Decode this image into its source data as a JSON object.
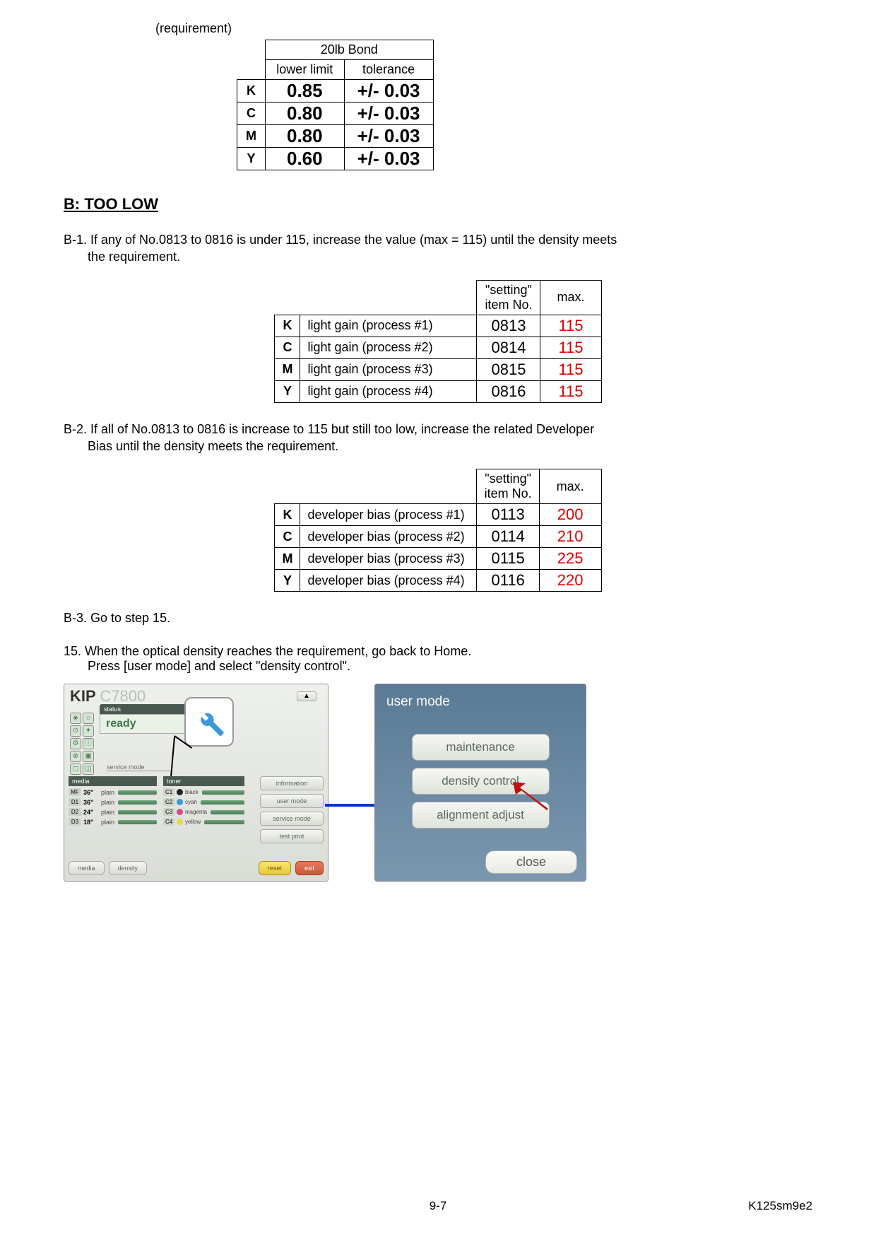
{
  "labels": {
    "requirement": "(requirement)",
    "section_b_title": "B: TOO LOW",
    "b1_text": "B-1. If any of No.0813 to 0816 is under 115, increase the value (max = 115) until the density meets",
    "b1_cont": "the requirement.",
    "b2_text": "B-2. If all of No.0813 to 0816 is increase to 115 but still too low, increase the related Developer",
    "b2_cont": "Bias until the density meets the requirement.",
    "b3_text": "B-3. Go to step 15.",
    "step15_a": "15. When the optical density reaches the requirement, go back to Home.",
    "step15_b": "Press [user mode] and select \"density control\"."
  },
  "req_table": {
    "group_header": "20lb Bond",
    "col1": "lower limit",
    "col2": "tolerance",
    "rows": [
      {
        "label": "K",
        "limit": "0.85",
        "tol": "+/- 0.03"
      },
      {
        "label": "C",
        "limit": "0.80",
        "tol": "+/- 0.03"
      },
      {
        "label": "M",
        "limit": "0.80",
        "tol": "+/- 0.03"
      },
      {
        "label": "Y",
        "limit": "0.60",
        "tol": "+/- 0.03"
      }
    ]
  },
  "setting_headers": {
    "col_setting": "\"setting\"",
    "col_itemno": "item No.",
    "col_max": "max."
  },
  "light_gain_table": [
    {
      "k": "K",
      "desc": "light gain (process #1)",
      "num": "0813",
      "max": "115"
    },
    {
      "k": "C",
      "desc": "light gain (process #2)",
      "num": "0814",
      "max": "115"
    },
    {
      "k": "M",
      "desc": "light gain (process #3)",
      "num": "0815",
      "max": "115"
    },
    {
      "k": "Y",
      "desc": "light gain (process #4)",
      "num": "0816",
      "max": "115"
    }
  ],
  "dev_bias_table": [
    {
      "k": "K",
      "desc": "developer bias (process #1)",
      "num": "0113",
      "max": "200"
    },
    {
      "k": "C",
      "desc": "developer bias (process #2)",
      "num": "0114",
      "max": "210"
    },
    {
      "k": "M",
      "desc": "developer bias (process #3)",
      "num": "0115",
      "max": "225"
    },
    {
      "k": "Y",
      "desc": "developer bias (process #4)",
      "num": "0116",
      "max": "220"
    }
  ],
  "left_screen": {
    "brand": "KIP",
    "model": "C7800",
    "status_label": "status",
    "ready": "ready",
    "service_mode": "service mode",
    "media_title": "media",
    "toner_title": "toner",
    "media": [
      {
        "slot": "MF",
        "size": "36\"",
        "type": "plain"
      },
      {
        "slot": "D1",
        "size": "36\"",
        "type": "plain"
      },
      {
        "slot": "D2",
        "size": "24\"",
        "type": "plain"
      },
      {
        "slot": "D3",
        "size": "18\"",
        "type": "plain"
      }
    ],
    "toner": [
      {
        "slot": "C1",
        "name": "black",
        "color": "#222"
      },
      {
        "slot": "C2",
        "name": "cyan",
        "color": "#3a9ad8"
      },
      {
        "slot": "C3",
        "name": "magenta",
        "color": "#d84a8a"
      },
      {
        "slot": "C4",
        "name": "yellow",
        "color": "#e8d84a"
      }
    ],
    "right_btns": [
      "information",
      "user mode",
      "service mode",
      "test print"
    ],
    "bottom_left": [
      "media",
      "density"
    ],
    "reset": "reset",
    "exit": "exit",
    "arrow_up": "▲"
  },
  "right_screen": {
    "title": "user mode",
    "buttons": [
      "maintenance",
      "density control",
      "alignment adjust"
    ],
    "close": "close"
  },
  "footer": {
    "page": "9-7",
    "doc": "K125sm9e2"
  }
}
